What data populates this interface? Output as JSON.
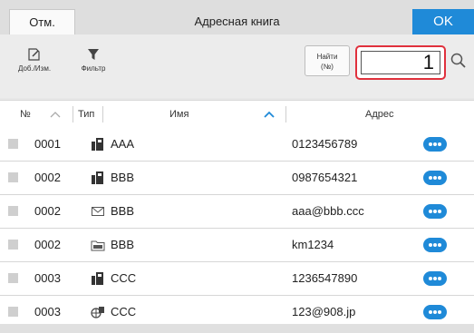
{
  "header": {
    "cancel_label": "Отм.",
    "title": "Адресная книга",
    "ok_label": "OK"
  },
  "toolbar": {
    "edit_label": "Доб./Изм.",
    "filter_label": "Фильтр",
    "find_label_line1": "Найти",
    "find_label_line2": "(№)",
    "find_value": "1"
  },
  "columns": {
    "num": "№",
    "type": "Тип",
    "name": "Имя",
    "address": "Адрес"
  },
  "rows": [
    {
      "num": "0001",
      "type_icon": "fax-icon",
      "name": "AAA",
      "address": "0123456789"
    },
    {
      "num": "0002",
      "type_icon": "fax-icon",
      "name": "BBB",
      "address": "0987654321"
    },
    {
      "num": "0002",
      "type_icon": "email-icon",
      "name": "BBB",
      "address": "aaa@bbb.ccc"
    },
    {
      "num": "0002",
      "type_icon": "smb-folder-icon",
      "name": "BBB",
      "address": "km1234"
    },
    {
      "num": "0003",
      "type_icon": "fax-icon",
      "name": "CCC",
      "address": "1236547890"
    },
    {
      "num": "0003",
      "type_icon": "ifax-icon",
      "name": "CCC",
      "address": "123@908.jp"
    }
  ],
  "colors": {
    "accent": "#1f8ad8",
    "highlight": "#e0313d"
  }
}
